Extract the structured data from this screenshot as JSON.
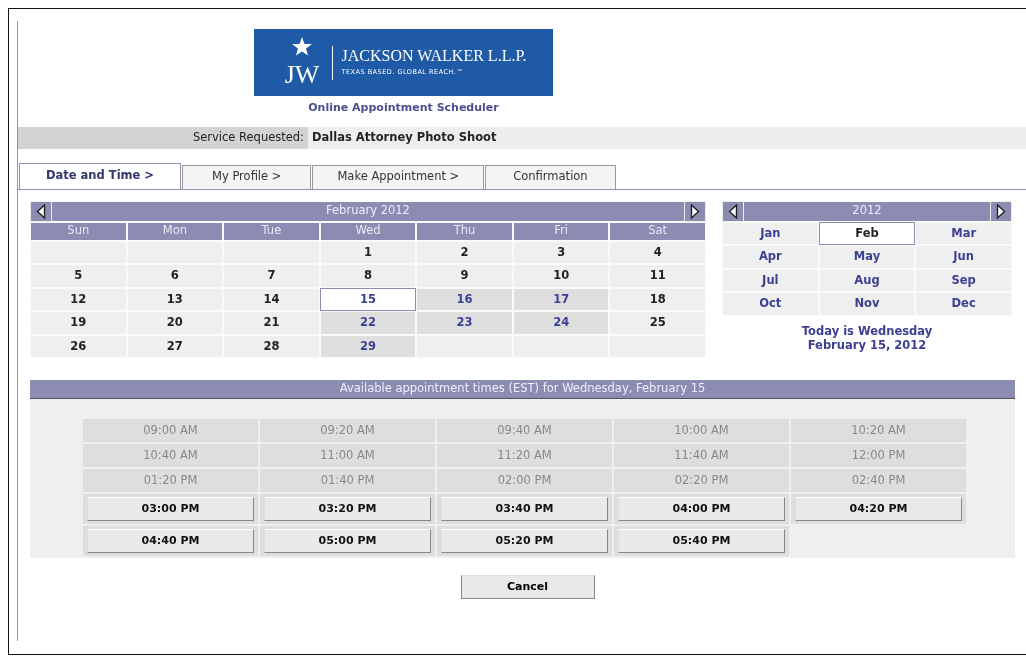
{
  "logo": {
    "monogram": "JW",
    "name": "JACKSON WALKER L.L.P.",
    "tagline": "TEXAS BASED. GLOBAL REACH.™"
  },
  "app_title": "Online Appointment Scheduler",
  "service": {
    "label": "Service Requested:",
    "value": "Dallas Attorney Photo Shoot"
  },
  "tabs": [
    {
      "label": "Date and Time >",
      "selected": true
    },
    {
      "label": "My Profile >",
      "selected": false
    },
    {
      "label": "Make Appointment >",
      "selected": false
    },
    {
      "label": "Confirmation",
      "selected": false
    }
  ],
  "calendar": {
    "title": "February 2012",
    "weekdays": [
      "Sun",
      "Mon",
      "Tue",
      "Wed",
      "Thu",
      "Fri",
      "Sat"
    ],
    "weeks": [
      [
        {
          "day": "1",
          "available": false,
          "selected": false
        },
        {
          "day": "2",
          "available": false,
          "selected": false
        },
        {
          "day": "3",
          "available": false,
          "selected": false
        },
        {
          "day": "4",
          "available": false,
          "selected": false
        }
      ],
      [
        {
          "day": "5",
          "available": false,
          "selected": false
        },
        {
          "day": "6",
          "available": false,
          "selected": false
        },
        {
          "day": "7",
          "available": false,
          "selected": false
        },
        {
          "day": "8",
          "available": false,
          "selected": false
        },
        {
          "day": "9",
          "available": false,
          "selected": false
        },
        {
          "day": "10",
          "available": false,
          "selected": false
        },
        {
          "day": "11",
          "available": false,
          "selected": false
        }
      ],
      [
        {
          "day": "12",
          "available": false,
          "selected": false
        },
        {
          "day": "13",
          "available": false,
          "selected": false
        },
        {
          "day": "14",
          "available": false,
          "selected": false
        },
        {
          "day": "15",
          "available": true,
          "selected": true
        },
        {
          "day": "16",
          "available": true,
          "selected": false
        },
        {
          "day": "17",
          "available": true,
          "selected": false
        },
        {
          "day": "18",
          "available": false,
          "selected": false
        }
      ],
      [
        {
          "day": "19",
          "available": false,
          "selected": false
        },
        {
          "day": "20",
          "available": false,
          "selected": false
        },
        {
          "day": "21",
          "available": false,
          "selected": false
        },
        {
          "day": "22",
          "available": true,
          "selected": false
        },
        {
          "day": "23",
          "available": true,
          "selected": false
        },
        {
          "day": "24",
          "available": true,
          "selected": false
        },
        {
          "day": "25",
          "available": false,
          "selected": false
        }
      ],
      [
        {
          "day": "26",
          "available": false,
          "selected": false
        },
        {
          "day": "27",
          "available": false,
          "selected": false
        },
        {
          "day": "28",
          "available": false,
          "selected": false
        },
        {
          "day": "29",
          "available": true,
          "selected": false
        }
      ]
    ]
  },
  "year_picker": {
    "title": "2012",
    "months": [
      {
        "label": "Jan",
        "selected": false
      },
      {
        "label": "Feb",
        "selected": true
      },
      {
        "label": "Mar",
        "selected": false
      },
      {
        "label": "Apr",
        "selected": false
      },
      {
        "label": "May",
        "selected": false
      },
      {
        "label": "Jun",
        "selected": false
      },
      {
        "label": "Jul",
        "selected": false
      },
      {
        "label": "Aug",
        "selected": false
      },
      {
        "label": "Sep",
        "selected": false
      },
      {
        "label": "Oct",
        "selected": false
      },
      {
        "label": "Nov",
        "selected": false
      },
      {
        "label": "Dec",
        "selected": false
      }
    ]
  },
  "today": [
    "Today is Wednesday",
    "February 15, 2012"
  ],
  "times": {
    "title": "Available appointment times (EST) for Wednesday, February 15",
    "slots": [
      {
        "time": "09:00 AM",
        "available": false
      },
      {
        "time": "09:20 AM",
        "available": false
      },
      {
        "time": "09:40 AM",
        "available": false
      },
      {
        "time": "10:00 AM",
        "available": false
      },
      {
        "time": "10:20 AM",
        "available": false
      },
      {
        "time": "10:40 AM",
        "available": false
      },
      {
        "time": "11:00 AM",
        "available": false
      },
      {
        "time": "11:20 AM",
        "available": false
      },
      {
        "time": "11:40 AM",
        "available": false
      },
      {
        "time": "12:00 PM",
        "available": false
      },
      {
        "time": "01:20 PM",
        "available": false
      },
      {
        "time": "01:40 PM",
        "available": false
      },
      {
        "time": "02:00 PM",
        "available": false
      },
      {
        "time": "02:20 PM",
        "available": false
      },
      {
        "time": "02:40 PM",
        "available": false
      },
      {
        "time": "03:00 PM",
        "available": true
      },
      {
        "time": "03:20 PM",
        "available": true
      },
      {
        "time": "03:40 PM",
        "available": true
      },
      {
        "time": "04:00 PM",
        "available": true
      },
      {
        "time": "04:20 PM",
        "available": true
      },
      {
        "time": "04:40 PM",
        "available": true
      },
      {
        "time": "05:00 PM",
        "available": true
      },
      {
        "time": "05:20 PM",
        "available": true
      },
      {
        "time": "05:40 PM",
        "available": true
      }
    ]
  },
  "cancel_button": "Cancel"
}
